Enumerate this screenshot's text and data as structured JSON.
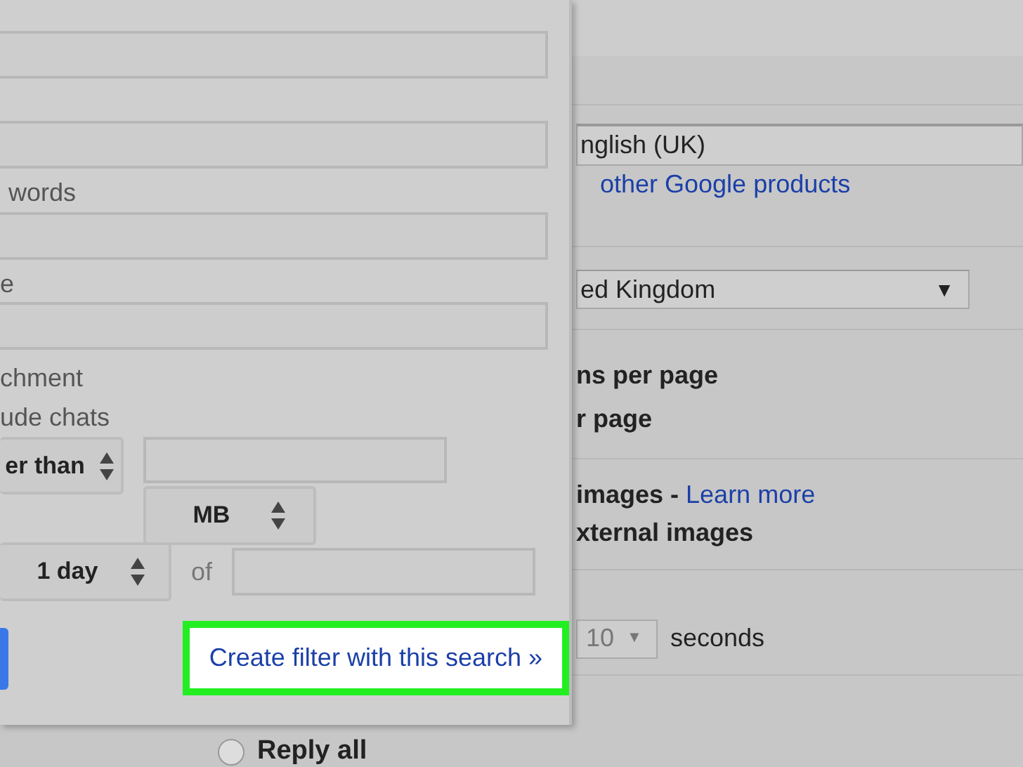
{
  "filter_panel": {
    "labels": [
      "words",
      "e",
      "chment",
      "ude chats"
    ],
    "size_operator": "er than",
    "size_unit": "MB",
    "date_range": "1 day",
    "of_label": "of",
    "create_filter_link": "Create filter with this search »"
  },
  "settings": {
    "language": "nglish (UK)",
    "language_link": "other Google products",
    "country": "ed Kingdom",
    "country_caret": "▼",
    "page_size_lines": [
      "ns per page",
      "r page"
    ],
    "images_label": "images - ",
    "images_link": "Learn more",
    "external_images": "xternal images",
    "undo_seconds": "10",
    "seconds_caret": "▼",
    "seconds_label": "seconds",
    "reply_option": {
      "label": "Reply all",
      "selected": false
    }
  }
}
